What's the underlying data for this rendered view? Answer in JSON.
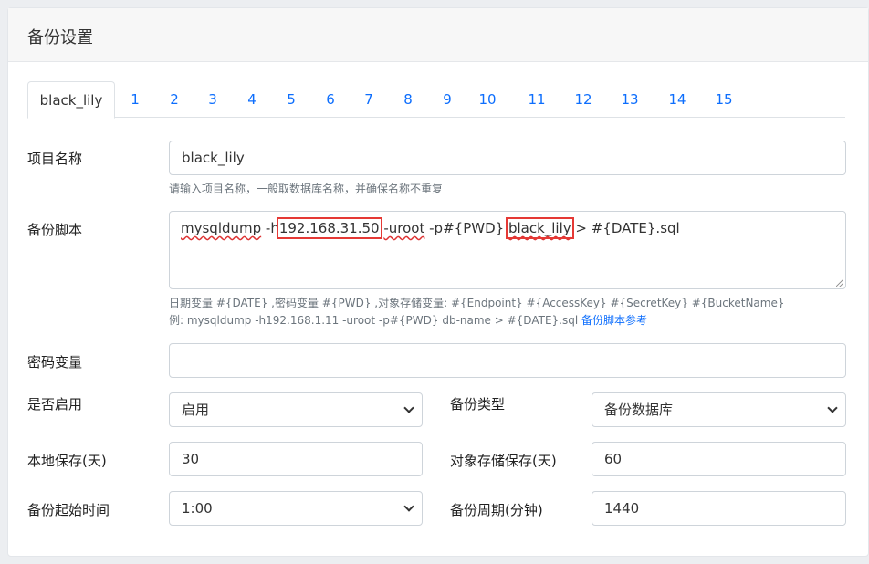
{
  "card": {
    "title": "备份设置"
  },
  "tabs": [
    "black_lily",
    "1",
    "2",
    "3",
    "4",
    "5",
    "6",
    "7",
    "8",
    "9",
    "10",
    "11",
    "12",
    "13",
    "14",
    "15"
  ],
  "form": {
    "project_name": {
      "label": "项目名称",
      "value": "black_lily",
      "help": "请输入项目名称，一般取数据库名称，并确保名称不重复"
    },
    "script": {
      "label": "备份脚本",
      "parts": {
        "p1": "mysqldump",
        "p2": " -h",
        "p3": "192.168.31.50",
        "p4": " ",
        "p5": "-uroot",
        "p6": " -p#{PWD} ",
        "p7": "black_lily",
        "p8": " > #{DATE}.sql"
      },
      "help_vars": "日期变量 #{DATE} ,密码变量 #{PWD} ,对象存储变量: #{Endpoint} #{AccessKey} #{SecretKey} #{BucketName}",
      "help_example": "例: mysqldump -h192.168.1.11 -uroot -p#{PWD} db-name > #{DATE}.sql ",
      "help_link": "备份脚本参考"
    },
    "password_var": {
      "label": "密码变量",
      "value": ""
    },
    "enabled": {
      "label": "是否启用",
      "value": "启用"
    },
    "backup_type": {
      "label": "备份类型",
      "value": "备份数据库"
    },
    "local_keep": {
      "label": "本地保存(天)",
      "value": "30"
    },
    "oss_keep": {
      "label": "对象存储保存(天)",
      "value": "60"
    },
    "start_time": {
      "label": "备份起始时间",
      "value": "1:00"
    },
    "period": {
      "label": "备份周期(分钟)",
      "value": "1440"
    }
  }
}
